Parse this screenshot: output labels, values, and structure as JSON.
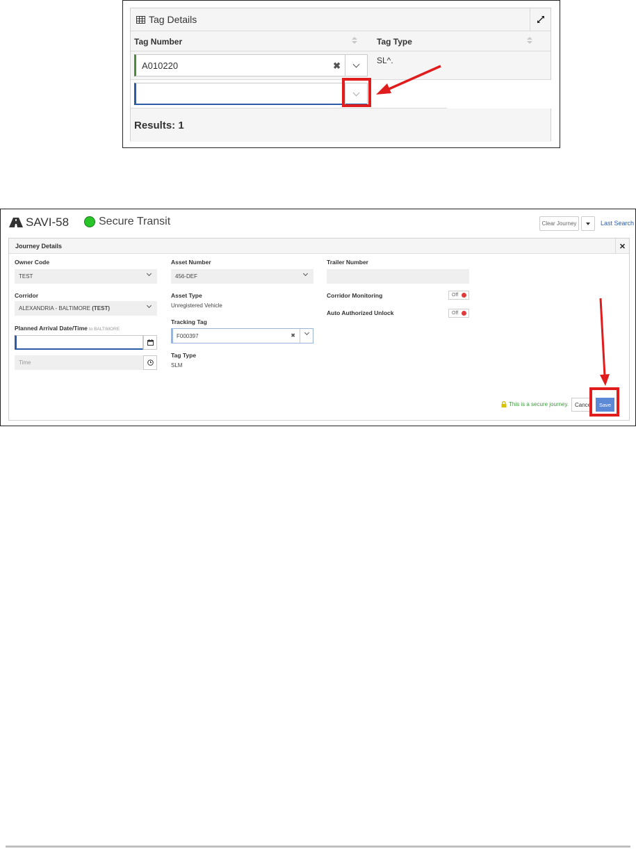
{
  "tag_details": {
    "title": "Tag Details",
    "columns": [
      "Tag Number",
      "Tag Type"
    ],
    "rows": [
      {
        "tag_number": "A010220",
        "tag_type": "SL^."
      },
      {
        "tag_number": "",
        "tag_type": ""
      }
    ],
    "results_label": "Results: 1"
  },
  "journey": {
    "app_title": "SAVI-58",
    "status": "Secure Transit",
    "status_color": "#28c428",
    "clear_journey_label": "Clear Journey",
    "last_search_label": "Last Search",
    "panel_title": "Journey Details",
    "owner_code": {
      "label": "Owner Code",
      "value": "TEST"
    },
    "corridor": {
      "label": "Corridor",
      "value_prefix": "ALEXANDRIA - BALTIMORE ",
      "value_bold": "(TEST)"
    },
    "planned_arrival": {
      "label": "Planned Arrival Date/Time",
      "sub": "to BALTIMORE",
      "date_value": "",
      "time_placeholder": "Time"
    },
    "asset_number": {
      "label": "Asset Number",
      "value": "456-DEF"
    },
    "asset_type": {
      "label": "Asset Type",
      "value": "Unregistered Vehicle"
    },
    "tracking_tag": {
      "label": "Tracking Tag",
      "value": "F000397"
    },
    "tag_type": {
      "label": "Tag Type",
      "value": "SLM"
    },
    "trailer_number": {
      "label": "Trailer Number",
      "value": ""
    },
    "corridor_monitoring": {
      "label": "Corridor Monitoring",
      "state": "Off"
    },
    "auto_unlock": {
      "label": "Auto Authorized Unlock",
      "state": "Off"
    },
    "secure_note": "This is a secure journey.",
    "cancel_label": "Cancel",
    "save_label": "Save"
  },
  "colors": {
    "highlight": "#e01c1c",
    "save": "#5b89d6",
    "link": "#2b5ca8"
  }
}
